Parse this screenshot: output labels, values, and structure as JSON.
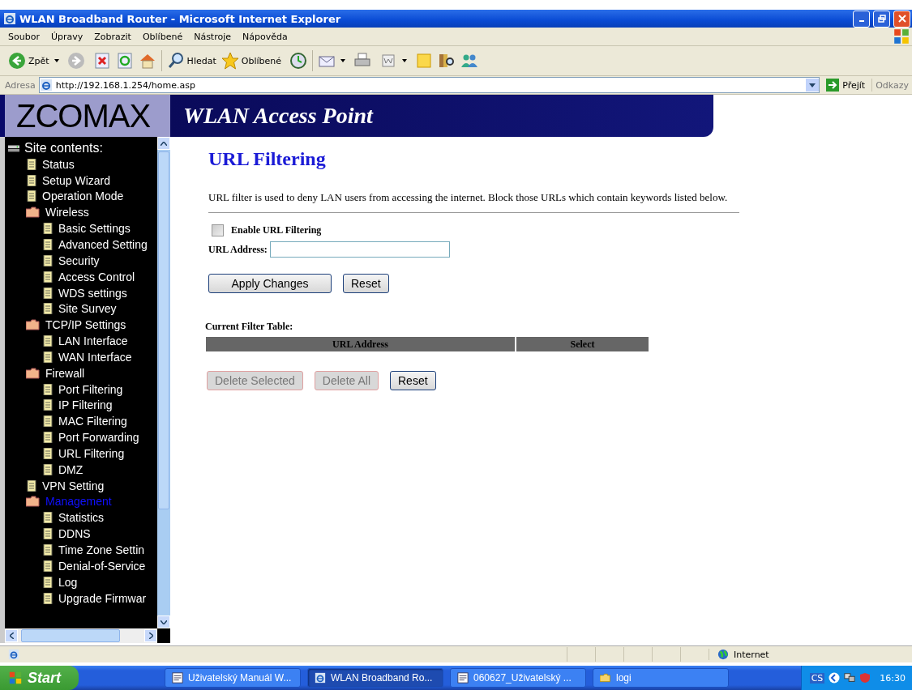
{
  "window": {
    "title": "WLAN Broadband Router - Microsoft Internet Explorer"
  },
  "menu": [
    "Soubor",
    "Úpravy",
    "Zobrazit",
    "Oblíbené",
    "Nástroje",
    "Nápověda"
  ],
  "toolbar": {
    "back": "Zpět",
    "search": "Hledat",
    "favorites": "Oblíbené"
  },
  "address": {
    "label": "Adresa",
    "value": "http://192.168.1.254/home.asp",
    "go": "Přejít",
    "links": "Odkazy"
  },
  "banner": {
    "logo": "ZCOMAX",
    "title": "WLAN Access Point"
  },
  "sidebar": {
    "heading": "Site contents:",
    "items": [
      {
        "label": "Status",
        "kind": "page",
        "selected": false
      },
      {
        "label": "Setup Wizard",
        "kind": "page",
        "selected": false
      },
      {
        "label": "Operation Mode",
        "kind": "page",
        "selected": false
      },
      {
        "label": "Wireless",
        "kind": "folder",
        "selected": false,
        "children": [
          {
            "label": "Basic Settings",
            "kind": "page",
            "selected": false
          },
          {
            "label": "Advanced Setting",
            "kind": "page",
            "selected": false
          },
          {
            "label": "Security",
            "kind": "page",
            "selected": false
          },
          {
            "label": "Access Control",
            "kind": "page",
            "selected": false
          },
          {
            "label": "WDS settings",
            "kind": "page",
            "selected": false
          },
          {
            "label": "Site Survey",
            "kind": "page",
            "selected": false
          }
        ]
      },
      {
        "label": "TCP/IP Settings",
        "kind": "folder",
        "selected": false,
        "children": [
          {
            "label": "LAN Interface",
            "kind": "page",
            "selected": false
          },
          {
            "label": "WAN Interface",
            "kind": "page",
            "selected": false
          }
        ]
      },
      {
        "label": "Firewall",
        "kind": "folder",
        "selected": false,
        "children": [
          {
            "label": "Port Filtering",
            "kind": "page",
            "selected": false
          },
          {
            "label": "IP Filtering",
            "kind": "page",
            "selected": false
          },
          {
            "label": "MAC Filtering",
            "kind": "page",
            "selected": false
          },
          {
            "label": "Port Forwarding",
            "kind": "page",
            "selected": false
          },
          {
            "label": "URL Filtering",
            "kind": "page",
            "selected": false
          },
          {
            "label": "DMZ",
            "kind": "page",
            "selected": false
          }
        ]
      },
      {
        "label": "VPN Setting",
        "kind": "page",
        "selected": false
      },
      {
        "label": "Management",
        "kind": "folder",
        "selected": true,
        "children": [
          {
            "label": "Statistics",
            "kind": "page",
            "selected": false
          },
          {
            "label": "DDNS",
            "kind": "page",
            "selected": false
          },
          {
            "label": "Time Zone Settin",
            "kind": "page",
            "selected": false
          },
          {
            "label": "Denial-of-Service",
            "kind": "page",
            "selected": false
          },
          {
            "label": "Log",
            "kind": "page",
            "selected": false
          },
          {
            "label": "Upgrade Firmwar",
            "kind": "page",
            "selected": false
          }
        ]
      }
    ]
  },
  "page": {
    "title": "URL Filtering",
    "description": "URL filter is used to deny LAN users from accessing the internet. Block those URLs which contain keywords listed below.",
    "enable": {
      "label": "Enable URL Filtering",
      "checked": false
    },
    "url_label": "URL Address:",
    "buttons": [
      {
        "label": "Apply Changes",
        "disabled": false
      },
      {
        "label": "Reset",
        "disabled": false
      }
    ],
    "table": {
      "title": "Current Filter Table:",
      "columns": [
        "URL Address",
        "Select"
      ]
    },
    "table_buttons": [
      {
        "label": "Delete Selected",
        "disabled": true
      },
      {
        "label": "Delete All",
        "disabled": true
      },
      {
        "label": "Reset",
        "disabled": false
      }
    ]
  },
  "status_bar": {
    "zone": "Internet"
  },
  "taskbar": {
    "start": "Start",
    "tasks": [
      {
        "label": "Uživatelský Manuál W...",
        "kind": "doc",
        "selected": false
      },
      {
        "label": "WLAN Broadband Ro...",
        "kind": "ie",
        "selected": true
      },
      {
        "label": "060627_Uživatelský ...",
        "kind": "doc",
        "selected": false
      },
      {
        "label": "logi",
        "kind": "folder",
        "selected": false
      }
    ],
    "language": "CS",
    "clock": "16:30"
  }
}
